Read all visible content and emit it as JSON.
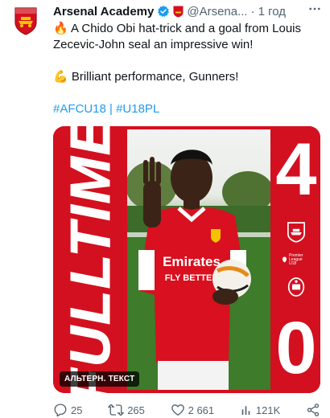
{
  "tweet": {
    "author_name": "Arsenal Academy",
    "handle": "@Arsena...",
    "separator": "·",
    "time": "1 год",
    "more_icon": "more-icon",
    "lines": [
      "🔥 A Chido Obi hat-trick and a goal from Louis Zecevic-John seal an impressive win!",
      "💪 Brilliant performance, Gunners!"
    ],
    "hashtags": [
      "#AFCU18",
      "#U18PL"
    ],
    "hashtag_sep": " | "
  },
  "media": {
    "banner_text": "FULLTIME",
    "score_top": "4",
    "score_bottom": "0",
    "alt_badge": "АЛЬТЕРН. ТЕКСТ",
    "shirt_sponsor": "Emirates",
    "shirt_sponsor_2": "FLY BETTER",
    "premier_league_text": "Premier League U18"
  },
  "actions": {
    "replies": "25",
    "reposts": "265",
    "likes": "2 661",
    "views": "121K"
  },
  "colors": {
    "arsenal_red": "#d3101f",
    "twitter_blue": "#1d9bf0",
    "muted": "#536471"
  }
}
